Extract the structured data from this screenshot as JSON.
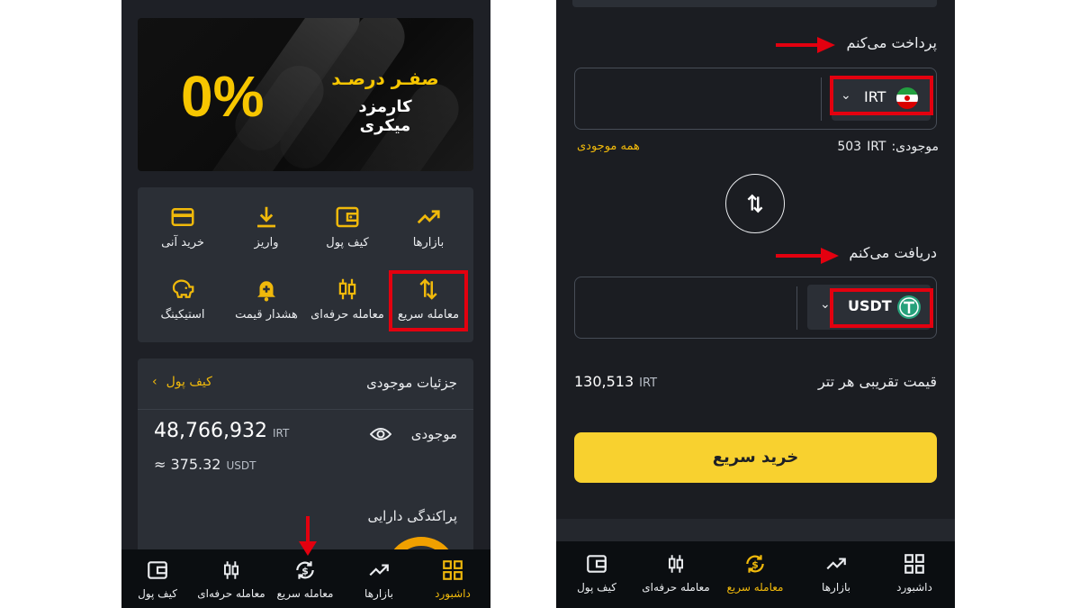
{
  "left": {
    "banner": {
      "percent": "0%",
      "line1": "صفـر درصـد",
      "line2": "کارمزد میکری"
    },
    "shortcuts": [
      {
        "label": "بازارها",
        "icon": "trend-chart-icon"
      },
      {
        "label": "کیف پول",
        "icon": "wallet-icon"
      },
      {
        "label": "واریز",
        "icon": "download-icon"
      },
      {
        "label": "خرید آنی",
        "icon": "credit-card-icon"
      },
      {
        "label": "معامله سریع",
        "icon": "swap-arrows-icon",
        "highlighted": true
      },
      {
        "label": "معامله حرفه‌ای",
        "icon": "candlestick-icon"
      },
      {
        "label": "هشدار قیمت",
        "icon": "bell-plus-icon"
      },
      {
        "label": "استیکینگ",
        "icon": "piggy-bank-icon"
      }
    ],
    "details": {
      "title": "جزئیات موجودی",
      "wallet_link": "کیف پول",
      "balance_label": "موجودی",
      "balance_value": "48,766,932",
      "balance_unit": "IRT",
      "approx_value": "≈ 375.32",
      "approx_unit": "USDT",
      "distribution_title": "پراکندگی دارایی"
    },
    "bottom_nav": [
      {
        "label": "داشبورد",
        "icon": "dashboard-grid-icon",
        "active": true
      },
      {
        "label": "بازارها",
        "icon": "trend-chart-icon",
        "active": false
      },
      {
        "label": "معامله سریع",
        "icon": "dollar-swap-icon",
        "active": false
      },
      {
        "label": "معامله حرفه‌ای",
        "icon": "candlestick-icon",
        "active": false
      },
      {
        "label": "کیف پول",
        "icon": "wallet-icon",
        "active": false
      }
    ]
  },
  "right": {
    "pay_label": "پرداخت می‌کنم",
    "pay_currency": "IRT",
    "balance_label": "موجودی:",
    "balance_value": "503",
    "balance_unit": "IRT",
    "all_balance_link": "همه موجودی",
    "receive_label": "دریافت می‌کنم",
    "receive_currency": "USDT",
    "price_label": "قیمت تقریبی هر تتر",
    "price_value": "130,513",
    "price_unit": "IRT",
    "buy_button": "خرید سریع",
    "bottom_nav": [
      {
        "label": "داشبورد",
        "icon": "dashboard-grid-icon",
        "active": false
      },
      {
        "label": "بازارها",
        "icon": "trend-chart-icon",
        "active": false
      },
      {
        "label": "معامله سریع",
        "icon": "dollar-swap-icon",
        "active": true
      },
      {
        "label": "معامله حرفه‌ای",
        "icon": "candlestick-icon",
        "active": false
      },
      {
        "label": "کیف پول",
        "icon": "wallet-icon",
        "active": false
      }
    ]
  },
  "colors": {
    "accent": "#f0b90b",
    "highlight_red": "#e3000f",
    "background": "#1e2026",
    "card": "#2b2f36",
    "button": "#f8d12f"
  }
}
